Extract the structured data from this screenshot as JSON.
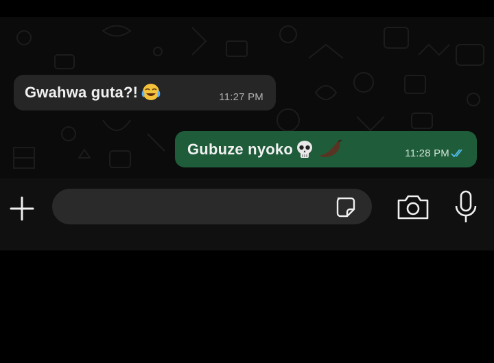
{
  "messages": {
    "incoming": {
      "text": "Gwahwa guta?!",
      "emoji": "face-with-tears-of-joy",
      "time": "11:27 PM"
    },
    "outgoing": {
      "text": "Gubuze nyoko",
      "emoji": [
        "skull",
        "brown-pepper"
      ],
      "time": "11:28 PM",
      "status": "read"
    }
  },
  "composer": {
    "placeholder": "",
    "value": ""
  },
  "icons": [
    "plus-icon",
    "sticker-icon",
    "camera-icon",
    "microphone-icon"
  ],
  "colors": {
    "incoming_bubble": "#262626",
    "outgoing_bubble": "#1f5c3a",
    "read_ticks": "#53bdeb"
  }
}
